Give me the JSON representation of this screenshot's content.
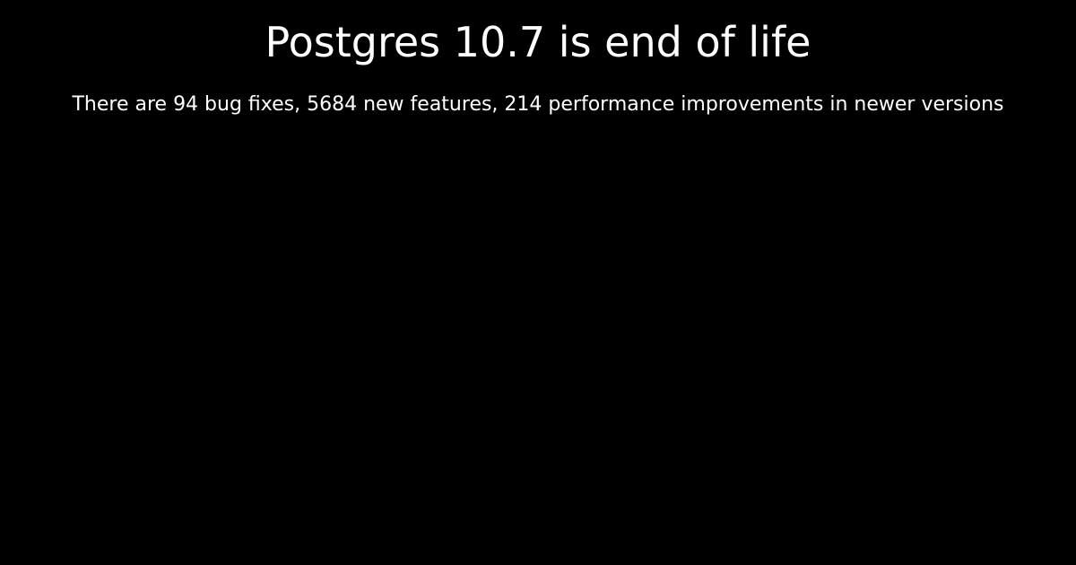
{
  "colors": {
    "background": "#000000",
    "text": "#ffffff"
  },
  "page": {
    "title": "Postgres 10.7 is end of life",
    "summary": "There are 94 bug fixes, 5684 new features, 214 performance improvements in newer versions"
  }
}
